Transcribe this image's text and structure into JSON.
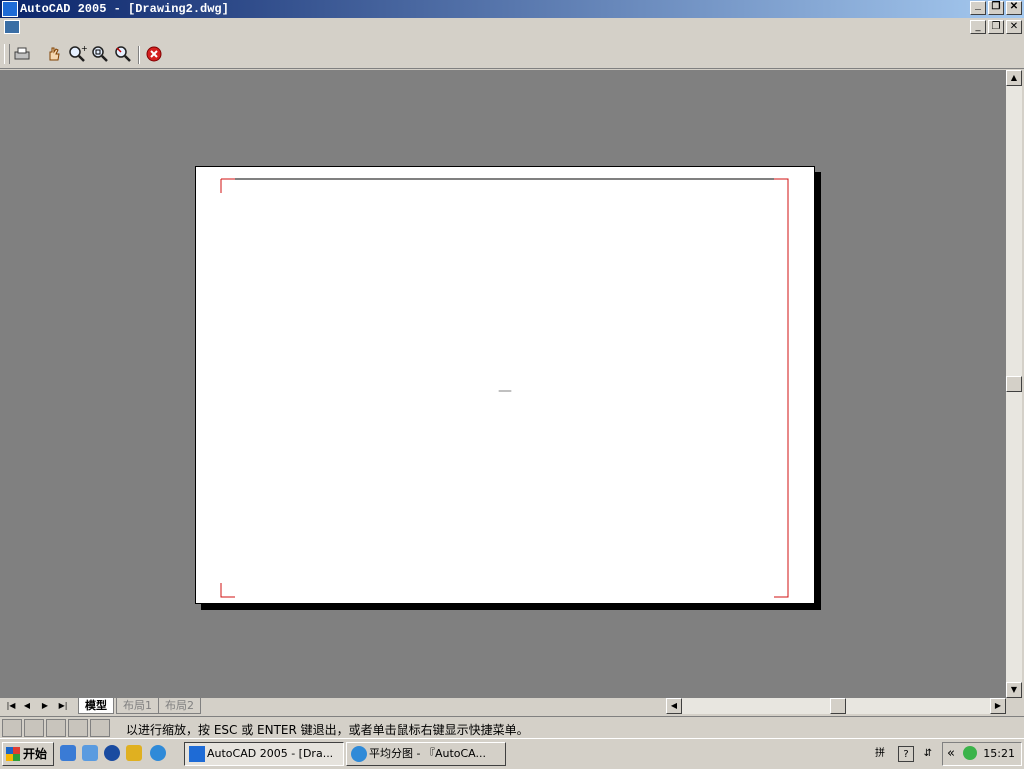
{
  "title_bar": {
    "title": "AutoCAD 2005 - [Drawing2.dwg]",
    "buttons": [
      "minimize",
      "restore",
      "close"
    ]
  },
  "document_bar": {
    "buttons": [
      "minimize",
      "restore",
      "close"
    ]
  },
  "toolbar": {
    "icons": [
      "print-icon",
      "pan-icon",
      "zoom-realtime-icon",
      "zoom-window-icon",
      "zoom-previous-icon",
      "close-preview-icon"
    ]
  },
  "drawing": {
    "text": "—"
  },
  "tabs": [
    {
      "label": "模型",
      "active": true
    },
    {
      "label": "布局1",
      "active": false
    },
    {
      "label": "布局2",
      "active": false
    }
  ],
  "status": {
    "prompt": "以进行缩放，按 ESC 或 ENTER 键退出，或者单击鼠标右键显示快捷菜单。"
  },
  "taskbar": {
    "start_label": "开始",
    "tasks": [
      {
        "label": "AutoCAD 2005 - [Dra...",
        "pressed": true
      },
      {
        "label": "平均分图 - 『AutoCA...",
        "pressed": false
      }
    ],
    "clock": "15:21"
  }
}
